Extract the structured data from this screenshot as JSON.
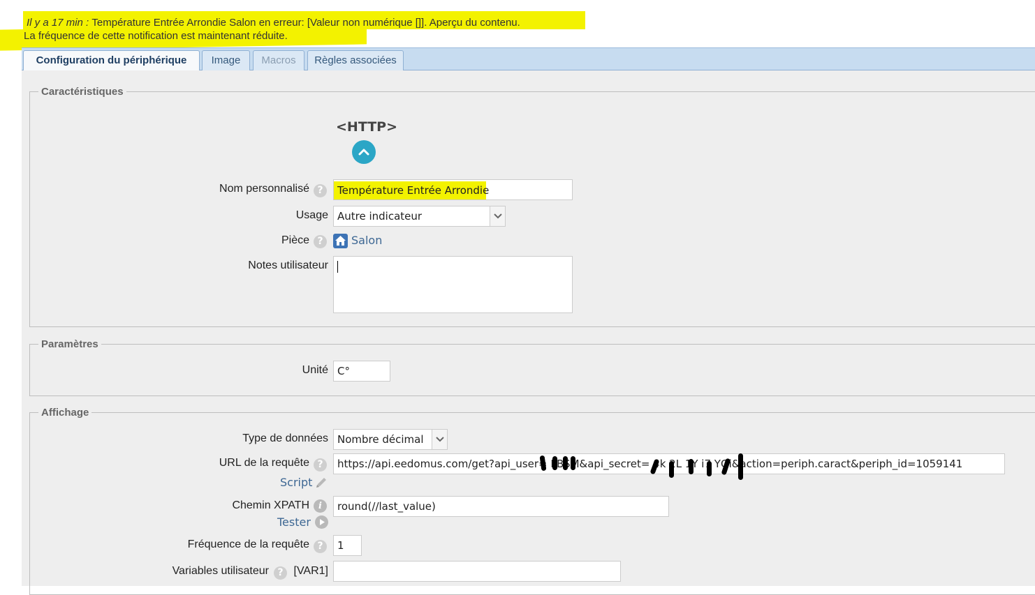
{
  "notification": {
    "time": "Il y a 17 min",
    "separator": " : ",
    "message": "Température Entrée Arrondie Salon en erreur: [Valeur non numérique []]. Aperçu du contenu.",
    "line2": "La fréquence de cette notification est maintenant réduite.",
    "highlight_color": "#f3f200"
  },
  "tabs": [
    {
      "label": "Configuration du périphérique",
      "state": "active"
    },
    {
      "label": "Image",
      "state": "normal"
    },
    {
      "label": "Macros",
      "state": "disabled"
    },
    {
      "label": "Règles associées",
      "state": "normal"
    }
  ],
  "caracteristiques": {
    "legend": "Caractéristiques",
    "type_label": "<HTTP>",
    "icon": "chevron-up-icon",
    "nom_label": "Nom personnalisé",
    "nom_value": "Température Entrée Arrondie",
    "usage_label": "Usage",
    "usage_value": "Autre indicateur",
    "piece_label": "Pièce",
    "piece_value": "Salon",
    "notes_label": "Notes utilisateur",
    "notes_value": ""
  },
  "parametres": {
    "legend": "Paramètres",
    "unite_label": "Unité",
    "unite_value": "C°"
  },
  "affichage": {
    "legend": "Affichage",
    "type_donnees_label": "Type de données",
    "type_donnees_value": "Nombre décimal",
    "url_label": "URL de la requête",
    "url_value": "https://api.eedomus.com/get?api_user=  FBSM&api_secret=  4k 2L  1Y  i7  YGi&action=periph.caract&periph_id=1059141",
    "script_link": "Script",
    "xpath_label": "Chemin XPATH",
    "xpath_value": "round(//last_value)",
    "tester_link": "Tester",
    "frequence_label": "Fréquence de la requête",
    "frequence_value": "1",
    "variables_label": "Variables utilisateur",
    "var1_label": "[VAR1]",
    "var1_value": ""
  },
  "colors": {
    "accent": "#2ba6c6",
    "tab_bar": "#c7dcf0",
    "link": "#3d6793",
    "panel_bg": "#eeeeee"
  }
}
